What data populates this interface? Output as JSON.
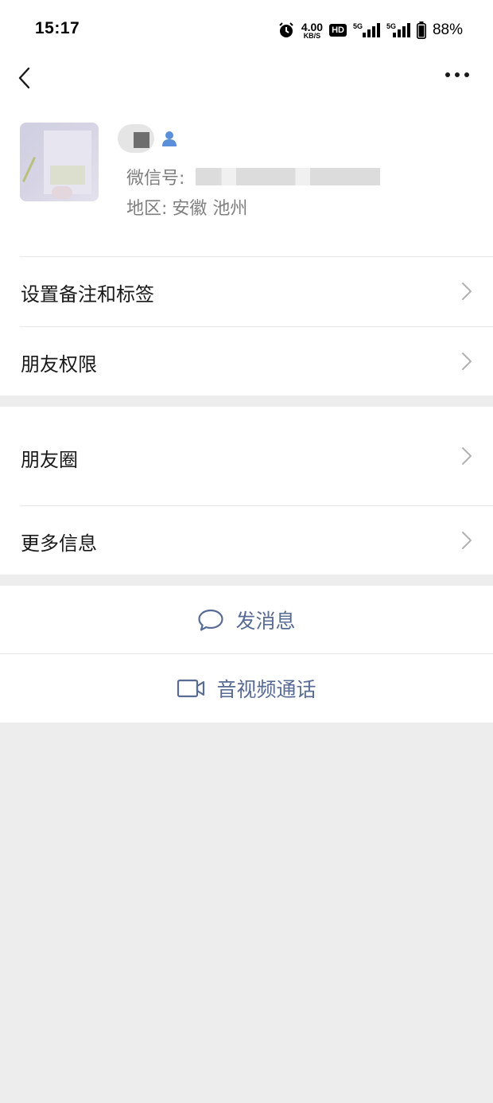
{
  "status_bar": {
    "time": "15:17",
    "net_speed_value": "4.00",
    "net_speed_unit": "KB/S",
    "hd_badge": "HD",
    "signal_1_label": "5G",
    "signal_2_label": "5G",
    "battery": "88%"
  },
  "profile": {
    "wechat_id_label": "微信号:",
    "region_label": "地区:",
    "region_value": "安徽  池州"
  },
  "menu": {
    "items": [
      {
        "label": "设置备注和标签"
      },
      {
        "label": "朋友权限"
      },
      {
        "label": "朋友圈"
      },
      {
        "label": "更多信息"
      }
    ]
  },
  "actions": {
    "message_label": "发消息",
    "call_label": "音视频通话"
  },
  "colors": {
    "link_blue": "#576b95",
    "page_background": "#ededed",
    "text_primary": "#191919",
    "text_secondary": "#7f7f7f"
  },
  "icons": {
    "back": "chevron-left-icon",
    "more": "more-dots-icon",
    "contact": "contact-person-icon",
    "message": "chat-bubble-icon",
    "call": "video-camera-icon",
    "row_arrow": "chevron-right-icon"
  }
}
